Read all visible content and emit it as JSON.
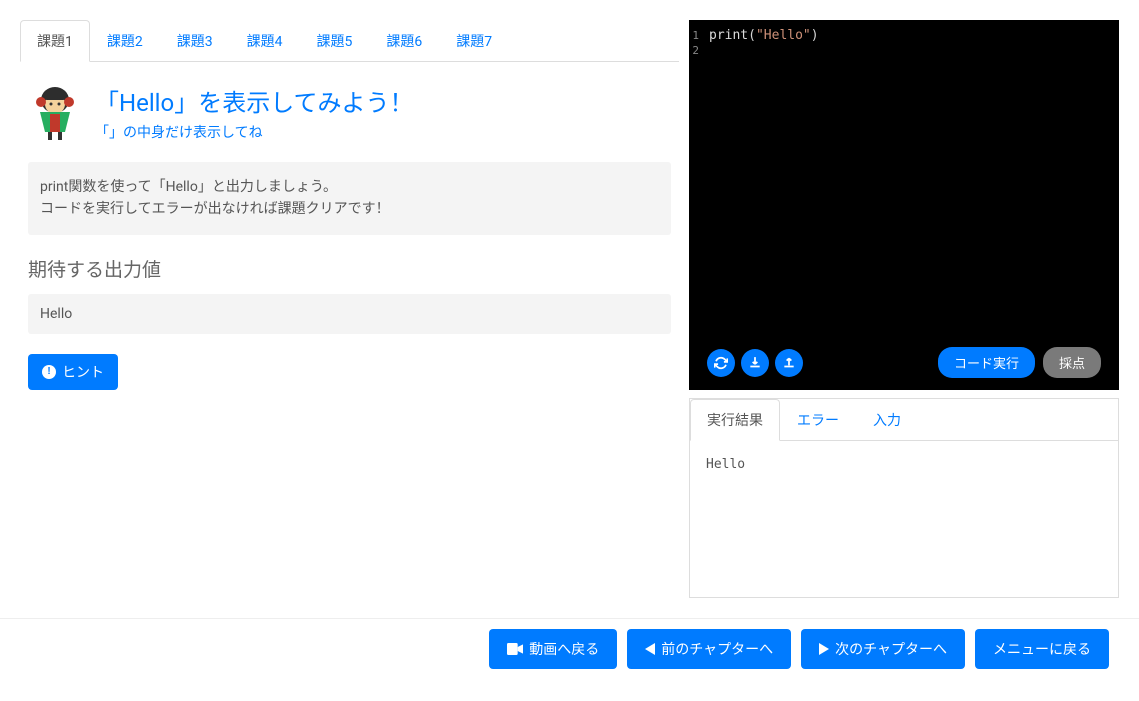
{
  "tabs": [
    {
      "label": "課題1",
      "active": true
    },
    {
      "label": "課題2",
      "active": false
    },
    {
      "label": "課題3",
      "active": false
    },
    {
      "label": "課題4",
      "active": false
    },
    {
      "label": "課題5",
      "active": false
    },
    {
      "label": "課題6",
      "active": false
    },
    {
      "label": "課題7",
      "active": false
    }
  ],
  "task": {
    "title": "「Hello」を表示してみよう！",
    "subtitle": "「」の中身だけ表示してね",
    "desc_line1": "print関数を使って「Hello」と出力しましょう。",
    "desc_line2": "コードを実行してエラーが出なければ課題クリアです！",
    "expected_title": "期待する出力値",
    "expected_output": "Hello"
  },
  "hint_label": "ヒント",
  "editor": {
    "lines": [
      {
        "no": "1",
        "func": "print",
        "open": "(",
        "string": "\"Hello\"",
        "close": ")"
      },
      {
        "no": "2",
        "func": "",
        "open": "",
        "string": "",
        "close": ""
      }
    ],
    "run_label": "コード実行",
    "grade_label": "採点"
  },
  "output": {
    "tabs": [
      {
        "label": "実行結果",
        "active": true
      },
      {
        "label": "エラー",
        "active": false
      },
      {
        "label": "入力",
        "active": false
      }
    ],
    "content": "Hello"
  },
  "footer": {
    "video": "動画へ戻る",
    "prev": "前のチャプターへ",
    "next": "次のチャプターへ",
    "menu": "メニューに戻る"
  }
}
